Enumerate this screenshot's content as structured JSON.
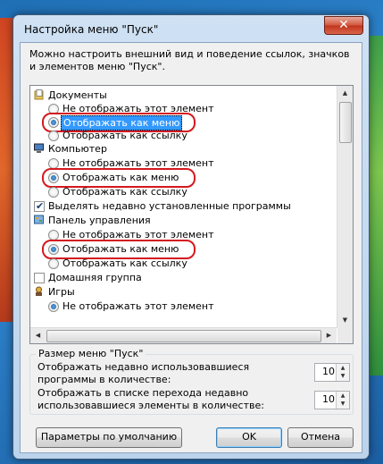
{
  "window": {
    "title": "Настройка меню \"Пуск\"",
    "close_symbol": "✕"
  },
  "intro_text": "Можно настроить внешний вид и поведение ссылок, значков и элементов меню \"Пуск\".",
  "list": {
    "documents": {
      "label": "Документы",
      "icon": "documents-folder-icon",
      "options": [
        "Не отображать этот элемент",
        "Отображать как меню",
        "Отображать как ссылку"
      ],
      "selected": "Отображать как меню"
    },
    "computer": {
      "label": "Компьютер",
      "icon": "computer-icon",
      "options": [
        "Не отображать этот элемент",
        "Отображать как меню",
        "Отображать как ссылку"
      ],
      "selected": "Отображать как меню"
    },
    "highlight_new_programs": {
      "label": "Выделять недавно установленные программы",
      "checked": true
    },
    "control_panel": {
      "label": "Панель управления",
      "icon": "control-panel-icon",
      "options": [
        "Не отображать этот элемент",
        "Отображать как меню",
        "Отображать как ссылку"
      ],
      "selected": "Отображать как меню"
    },
    "homegroup": {
      "label": "Домашняя группа",
      "checked": false
    },
    "games": {
      "label": "Игры",
      "icon": "games-icon",
      "options": [
        "Не отображать этот элемент"
      ]
    }
  },
  "size_group": {
    "title": "Размер меню \"Пуск\"",
    "recent_programs_label": "Отображать недавно использовавшиеся программы в количестве:",
    "recent_programs_value": "10",
    "jump_list_label": "Отображать в списке перехода недавно использовавшиеся элементы в количестве:",
    "jump_list_value": "10"
  },
  "buttons": {
    "defaults": "Параметры по умолчанию",
    "ok": "OK",
    "cancel": "Отмена"
  },
  "colors": {
    "selection": "#3399ff",
    "annotation_oval": "#d4191f"
  }
}
